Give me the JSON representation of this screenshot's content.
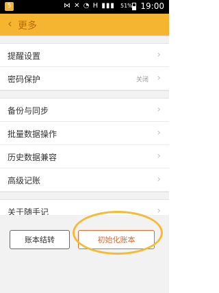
{
  "status_bar": {
    "app_badge": "5",
    "icons": "⋈ ✕ ◔ H ▮▮▮",
    "battery": "51%",
    "time": "19:00"
  },
  "nav": {
    "back_icon": "‹",
    "title": "更多"
  },
  "menu": {
    "items": [
      {
        "label": "提醒设置",
        "value": ""
      },
      {
        "label": "密码保护",
        "value": "关闭"
      },
      {
        "label": "备份与同步",
        "value": ""
      },
      {
        "label": "批量数据操作",
        "value": ""
      },
      {
        "label": "历史数据兼容",
        "value": ""
      },
      {
        "label": "高级记账",
        "value": ""
      },
      {
        "label": "关于随手记",
        "value": ""
      }
    ],
    "chevron": "›"
  },
  "buttons": {
    "transfer": "账本结转",
    "init": "初始化账本"
  },
  "colors": {
    "nav_bg": "#f5b531",
    "init_accent": "#e06a2c",
    "highlight": "#f4bc34"
  }
}
